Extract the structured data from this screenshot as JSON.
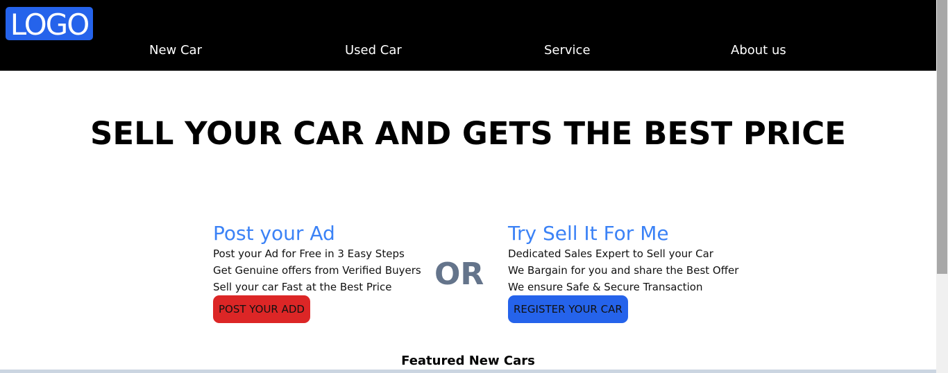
{
  "navbar": {
    "logo": "LOGO",
    "links": [
      "New Car",
      "Used Car",
      "Service",
      "About us"
    ]
  },
  "hero": {
    "title": "SELL YOUR CAR AND GETS THE BEST PRICE"
  },
  "post_ad": {
    "title": "Post your Ad",
    "lines": [
      "Post your Ad for Free in 3 Easy Steps",
      "Get Genuine offers from Verified Buyers",
      "Sell your car Fast at the Best Price"
    ],
    "button": "POST YOUR ADD"
  },
  "divider": {
    "text": "OR"
  },
  "sell_for_me": {
    "title": "Try Sell It For Me",
    "lines": [
      "Dedicated Sales Expert to Sell your Car",
      "We Bargain for you and share the Best Offer",
      "We ensure Safe & Secure Transaction"
    ],
    "button": "REGISTER YOUR CAR"
  },
  "featured": {
    "title": "Featured New Cars"
  },
  "colors": {
    "navbar_bg": "#000000",
    "logo_bg": "#2563eb",
    "accent_blue": "#3b82f6",
    "button_red": "#dc2626",
    "button_blue": "#2563eb",
    "or_gray": "#64748b"
  }
}
